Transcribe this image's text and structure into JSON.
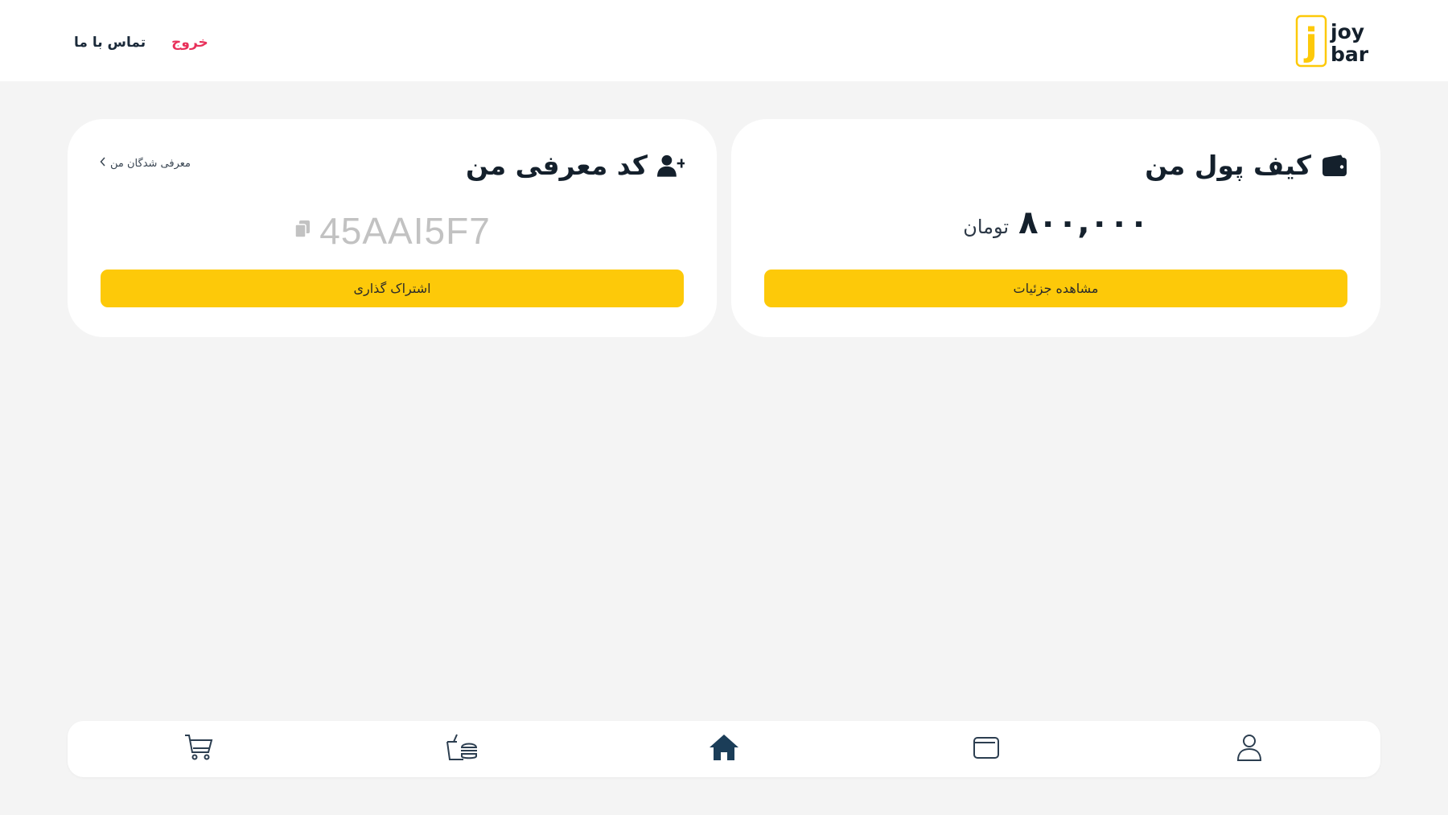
{
  "header": {
    "logo": {
      "line1": "joy",
      "line2": "bar",
      "mark": "j"
    },
    "contact_label": "تماس با ما",
    "logout_label": "خروج"
  },
  "wallet_card": {
    "title": "کیف پول من",
    "icon": "wallet-icon",
    "amount": "۸۰۰,۰۰۰",
    "currency": "تومان",
    "button_label": "مشاهده جزئیات"
  },
  "referral_card": {
    "title": "کد معرفی من",
    "icon": "user-plus-icon",
    "referrals_link_label": "معرفی شدگان من",
    "code": "45AAI5F7",
    "copy_icon": "copy-icon",
    "button_label": "اشتراک گذاری"
  },
  "bottom_nav": {
    "items": [
      {
        "icon": "cart-icon"
      },
      {
        "icon": "food-icon"
      },
      {
        "icon": "home-icon",
        "active": true
      },
      {
        "icon": "wallet-icon"
      },
      {
        "icon": "user-icon"
      }
    ]
  },
  "colors": {
    "accent": "#fdc909",
    "logout": "#e8305a",
    "text_dark": "#14202c",
    "background": "#f4f4f4"
  }
}
